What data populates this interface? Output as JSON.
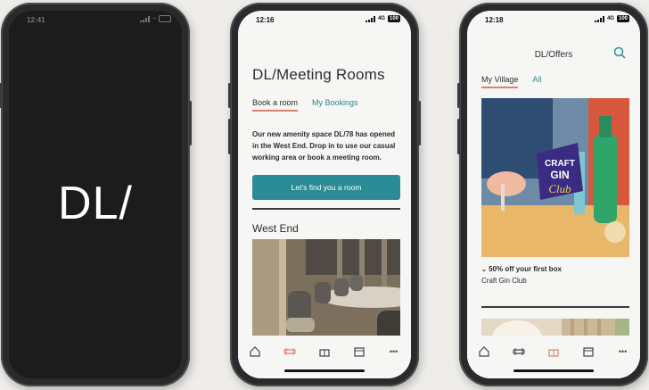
{
  "phone1": {
    "status_time": "12:41",
    "logo": "DL/"
  },
  "phone2": {
    "status_time": "12:16",
    "network": "4G",
    "battery": "100",
    "title": "DL/Meeting Rooms",
    "tabs": [
      {
        "label": "Book a room",
        "active": true
      },
      {
        "label": "My Bookings",
        "active": false
      }
    ],
    "intro": "Our new amenity space DL/78 has opened in the West End. Drop in to use our casual working area or book a meeting room.",
    "cta_label": "Let's find you a room",
    "section_title": "West End",
    "nav": [
      "home-icon",
      "meeting-room-icon",
      "gift-icon",
      "calendar-icon",
      "more-icon"
    ],
    "nav_more": "•••"
  },
  "phone3": {
    "status_time": "12:18",
    "network": "4G",
    "battery": "100",
    "title": "DL/Offers",
    "tabs": [
      {
        "label": "My Village",
        "active": true
      },
      {
        "label": "All",
        "active": false
      }
    ],
    "badge_line1": "CRAFT",
    "badge_line2": "GIN",
    "badge_line3": "Club",
    "offer_text": "50% off your first box",
    "offer_sub": "Craft Gin Club",
    "nav_more": "•••"
  },
  "colors": {
    "accent_teal": "#2b8c96",
    "accent_coral": "#d9826a",
    "background": "#efedea"
  }
}
